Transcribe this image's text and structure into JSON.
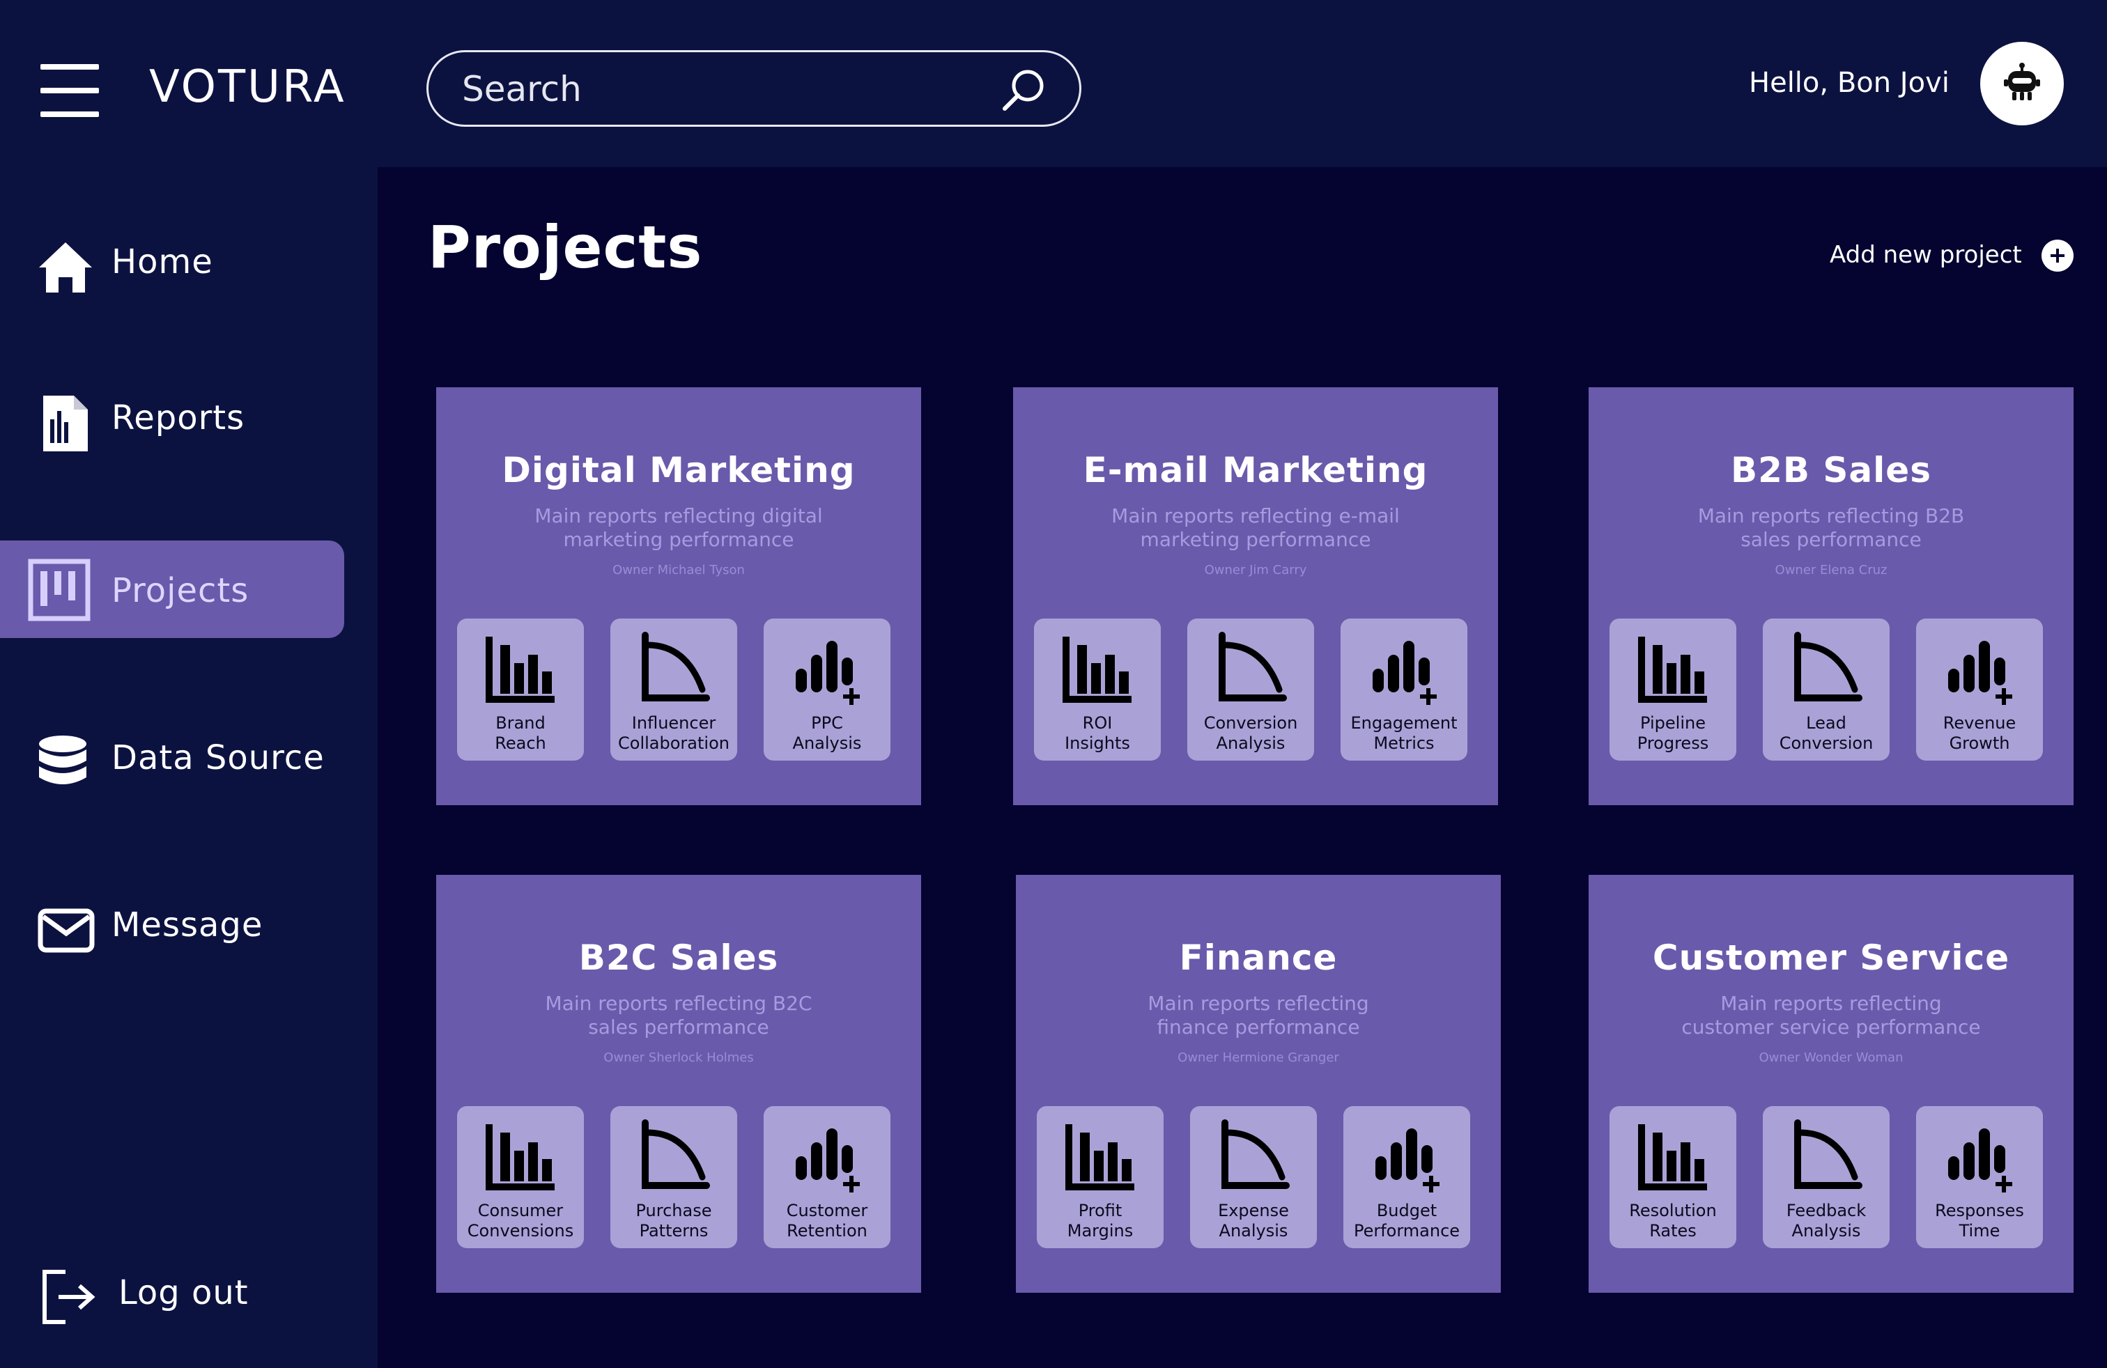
{
  "header": {
    "menu_icon": "hamburger-menu-icon",
    "brand": "VOTURA",
    "search_placeholder": "Search",
    "search_icon": "search-icon",
    "greeting": "Hello, Bon Jovi",
    "avatar_icon": "robot-avatar-icon"
  },
  "sidebar": {
    "items": [
      {
        "label": "Home",
        "icon": "home-icon",
        "active": false
      },
      {
        "label": "Reports",
        "icon": "report-document-icon",
        "active": false
      },
      {
        "label": "Projects",
        "icon": "kanban-board-icon",
        "active": true
      },
      {
        "label": "Data Source",
        "icon": "database-icon",
        "active": false
      },
      {
        "label": "Message",
        "icon": "envelope-icon",
        "active": false
      }
    ],
    "logout": {
      "label": "Log out",
      "icon": "logout-icon"
    }
  },
  "main": {
    "title": "Projects",
    "add_project_label": "Add new project",
    "add_icon": "plus-circle-icon",
    "projects": [
      {
        "title": "Digital Marketing",
        "desc_lines": [
          "Main reports reflecting digital",
          "marketing performance"
        ],
        "owner": "Owner Michael Tyson",
        "tiles": [
          {
            "line1": "Brand",
            "line2": "Reach",
            "icon": "bar-chart-icon"
          },
          {
            "line1": "Influencer",
            "line2": "Collaboration",
            "icon": "curve-chart-icon"
          },
          {
            "line1": "PPC",
            "line2": "Analysis",
            "icon": "bar-chart-plus-icon"
          }
        ]
      },
      {
        "title": "E-mail Marketing",
        "desc_lines": [
          "Main reports reflecting e-mail",
          "marketing performance"
        ],
        "owner": "Owner Jim Carry",
        "tiles": [
          {
            "line1": "ROI",
            "line2": "Insights",
            "icon": "bar-chart-icon"
          },
          {
            "line1": "Conversion",
            "line2": "Analysis",
            "icon": "curve-chart-icon"
          },
          {
            "line1": "Engagement",
            "line2": "Metrics",
            "icon": "bar-chart-plus-icon"
          }
        ]
      },
      {
        "title": "B2B Sales",
        "desc_lines": [
          "Main reports reflecting B2B",
          "sales performance"
        ],
        "owner": "Owner Elena Cruz",
        "tiles": [
          {
            "line1": "Pipeline",
            "line2": "Progress",
            "icon": "bar-chart-icon"
          },
          {
            "line1": "Lead",
            "line2": "Conversion",
            "icon": "curve-chart-icon"
          },
          {
            "line1": "Revenue",
            "line2": "Growth",
            "icon": "bar-chart-plus-icon"
          }
        ]
      },
      {
        "title": "B2C Sales",
        "desc_lines": [
          "Main reports reflecting B2C",
          "sales performance"
        ],
        "owner": "Owner Sherlock Holmes",
        "tiles": [
          {
            "line1": "Consumer",
            "line2": "Convensions",
            "icon": "bar-chart-icon"
          },
          {
            "line1": "Purchase",
            "line2": "Patterns",
            "icon": "curve-chart-icon"
          },
          {
            "line1": "Customer",
            "line2": "Retention",
            "icon": "bar-chart-plus-icon"
          }
        ]
      },
      {
        "title": "Finance",
        "desc_lines": [
          "Main reports reflecting",
          "finance performance"
        ],
        "owner": "Owner Hermione Granger",
        "tiles": [
          {
            "line1": "Profit",
            "line2": "Margins",
            "icon": "bar-chart-icon"
          },
          {
            "line1": "Expense",
            "line2": "Analysis",
            "icon": "curve-chart-icon"
          },
          {
            "line1": "Budget",
            "line2": "Performance",
            "icon": "bar-chart-plus-icon"
          }
        ]
      },
      {
        "title": "Customer Service",
        "desc_lines": [
          "Main reports reflecting",
          "customer service performance"
        ],
        "owner": "Owner Wonder Woman",
        "tiles": [
          {
            "line1": "Resolution",
            "line2": "Rates",
            "icon": "bar-chart-icon"
          },
          {
            "line1": "Feedback",
            "line2": "Analysis",
            "icon": "curve-chart-icon"
          },
          {
            "line1": "Responses",
            "line2": "Time",
            "icon": "bar-chart-plus-icon"
          }
        ]
      }
    ]
  },
  "colors": {
    "page_bg": "#050330",
    "bar_bg": "#0c1240",
    "accent": "#6a5aab",
    "tile_bg": "#aaa2d6"
  }
}
